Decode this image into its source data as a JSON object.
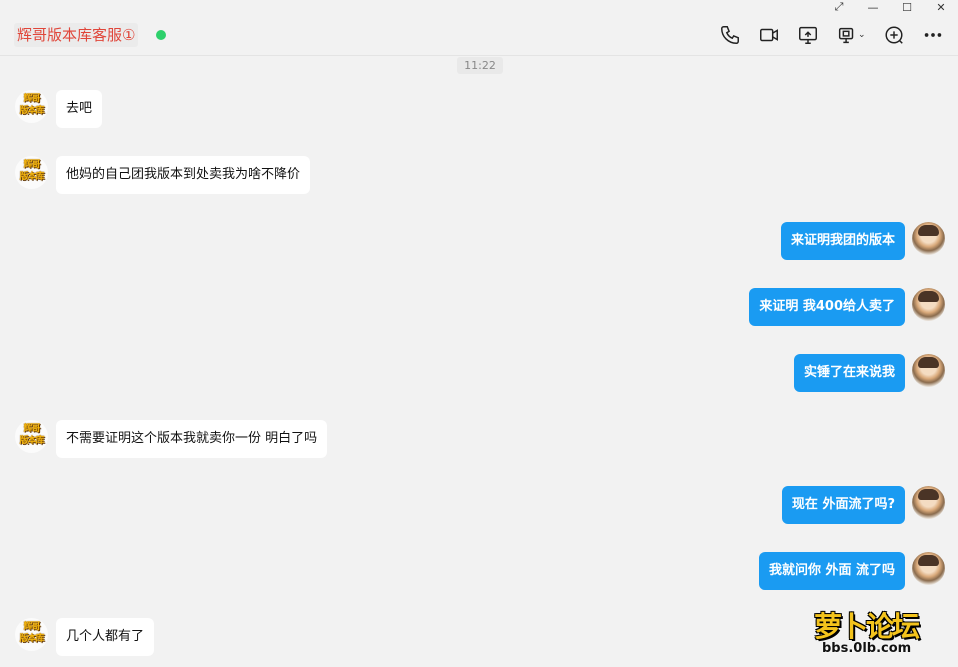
{
  "window": {
    "controls": [
      "⤢",
      "—",
      "☐",
      "✕"
    ]
  },
  "header": {
    "contact_name": "辉哥版本库客服①",
    "online_color": "#2dd06b",
    "toolbar_icons": [
      "phone-icon",
      "video-camera-icon",
      "screen-share-icon",
      "remote-control-icon",
      "add-member-icon",
      "more-icon"
    ]
  },
  "timestamp": "11:22",
  "contact_avatar_text": [
    "辉哥",
    "版本库"
  ],
  "messages": [
    {
      "side": "left",
      "text": "去吧"
    },
    {
      "side": "left",
      "text": "他妈的自己团我版本到处卖我为啥不降价"
    },
    {
      "side": "right",
      "text": "来证明我团的版本"
    },
    {
      "side": "right",
      "text": "来证明 我400给人卖了"
    },
    {
      "side": "right",
      "text": "实锤了在来说我"
    },
    {
      "side": "left",
      "text": "不需要证明这个版本我就卖你一份 明白了吗"
    },
    {
      "side": "right",
      "text": "现在 外面流了吗?"
    },
    {
      "side": "right",
      "text": "我就问你 外面 流了吗"
    },
    {
      "side": "left",
      "text": "几个人都有了"
    }
  ],
  "watermark": {
    "top": "萝卜论坛",
    "bottom": "bbs.0lb.com"
  },
  "colors": {
    "outgoing_bubble": "#1a9bf2",
    "incoming_bubble": "#ffffff",
    "contact_name": "#e0463a"
  }
}
